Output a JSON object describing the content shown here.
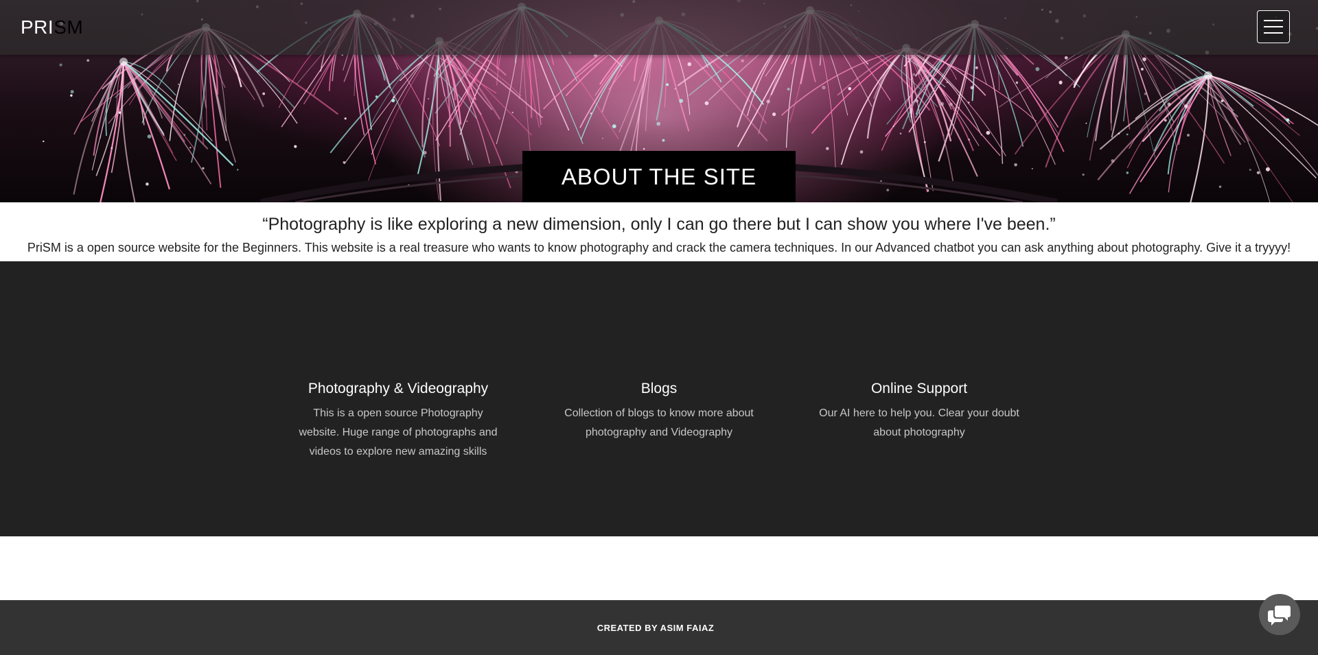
{
  "nav": {
    "logo_part1": "PRI",
    "logo_part2": "SM",
    "menu_icon": "hamburger-menu-icon"
  },
  "hero": {
    "title": "ABOUT THE SITE",
    "background": "fireworks-photo"
  },
  "about": {
    "quote": "“Photography is like exploring a new dimension, only I can go there but I can show you where I've been.”",
    "description": "PriSM is a open source website for the Beginners. This website is a real treasure who wants to know photography and crack the camera techniques. In our Advanced chatbot you can ask anything about photography. Give it a tryyyy!"
  },
  "features": [
    {
      "title": "Photography & Videography",
      "text": "This is a open source Photography website. Huge range of photographs and videos to explore new amazing skills"
    },
    {
      "title": "Blogs",
      "text": "Collection of blogs to know more about photography and Videography"
    },
    {
      "title": "Online Support",
      "text": "Our AI here to help you. Clear your doubt about photography"
    }
  ],
  "footer": {
    "credit": "CREATED BY ASIM FAIAZ"
  },
  "chat": {
    "icon": "chat-bubbles-icon"
  },
  "colors": {
    "nav_bg": "#2d2d2d",
    "features_bg": "#222222",
    "footer_bg": "#333333",
    "hero_title_bg": "#000000",
    "firework_pink": "#ff6fb0"
  }
}
